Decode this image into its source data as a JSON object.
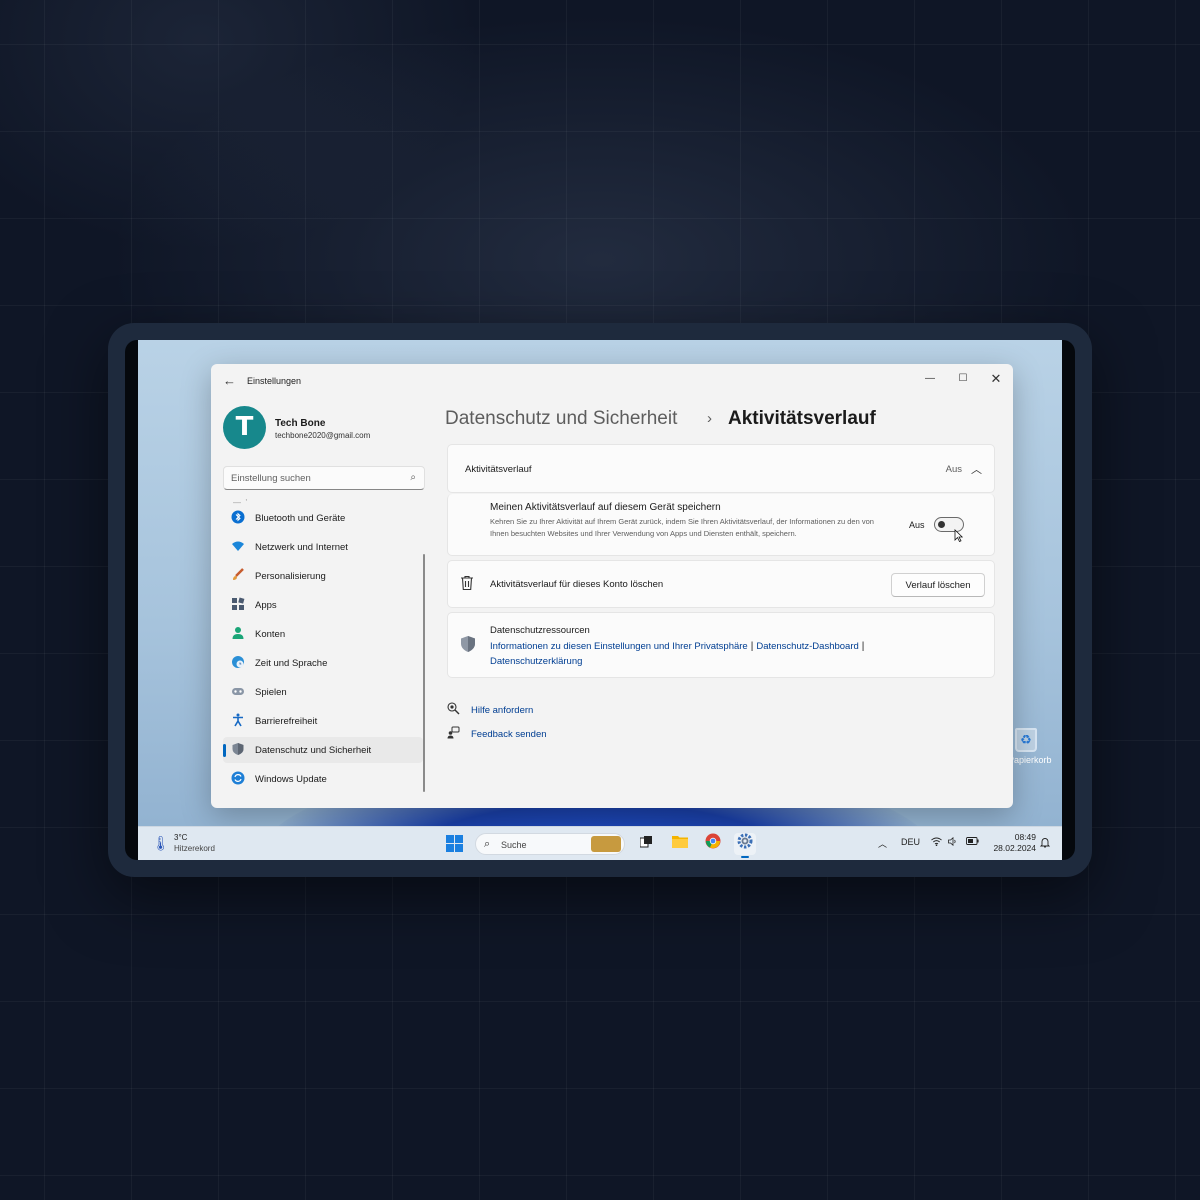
{
  "app": {
    "title": "Einstellungen"
  },
  "user": {
    "initial": "T",
    "name": "Tech Bone",
    "email": "techbone2020@gmail.com"
  },
  "search": {
    "placeholder": "Einstellung suchen"
  },
  "nav": {
    "items": [
      {
        "label": "Bluetooth und Geräte",
        "icon": "bluetooth-icon"
      },
      {
        "label": "Netzwerk und Internet",
        "icon": "wifi-icon"
      },
      {
        "label": "Personalisierung",
        "icon": "brush-icon"
      },
      {
        "label": "Apps",
        "icon": "apps-icon"
      },
      {
        "label": "Konten",
        "icon": "person-icon"
      },
      {
        "label": "Zeit und Sprache",
        "icon": "globe-clock-icon"
      },
      {
        "label": "Spielen",
        "icon": "gamepad-icon"
      },
      {
        "label": "Barrierefreiheit",
        "icon": "accessibility-icon"
      },
      {
        "label": "Datenschutz und Sicherheit",
        "icon": "shield-icon",
        "active": true
      },
      {
        "label": "Windows Update",
        "icon": "update-icon"
      }
    ]
  },
  "breadcrumb": {
    "parent": "Datenschutz und Sicherheit",
    "separator": "›",
    "current": "Aktivitätsverlauf"
  },
  "section": {
    "title": "Aktivitätsverlauf",
    "state": "Aus"
  },
  "history_setting": {
    "title": "Meinen Aktivitätsverlauf auf diesem Gerät speichern",
    "description": "Kehren Sie zu Ihrer Aktivität auf Ihrem Gerät zurück, indem Sie Ihren Aktivitätsverlauf, der Informationen zu den von Ihnen besuchten Websites und Ihrer Verwendung von Apps und Diensten enthält, speichern.",
    "state_label": "Aus",
    "toggle_on": false
  },
  "delete_history": {
    "label": "Aktivitätsverlauf für dieses Konto löschen",
    "button": "Verlauf löschen"
  },
  "resources": {
    "title": "Datenschutzressourcen",
    "link1": "Informationen zu diesen Einstellungen und Ihrer Privatsphäre",
    "link2": "Datenschutz-Dashboard",
    "link3": "Datenschutzerklärung"
  },
  "help": {
    "get_help": "Hilfe anfordern",
    "feedback": "Feedback senden"
  },
  "taskbar": {
    "weather_temp": "3°C",
    "weather_desc": "Hitzerekord",
    "search_label": "Suche",
    "language": "DEU",
    "time": "08:49",
    "date": "28.02.2024"
  },
  "desktop": {
    "recycle_label": "Papierkorb"
  },
  "colors": {
    "accent": "#0067c0",
    "link": "#003e92",
    "avatar": "#17888c"
  }
}
